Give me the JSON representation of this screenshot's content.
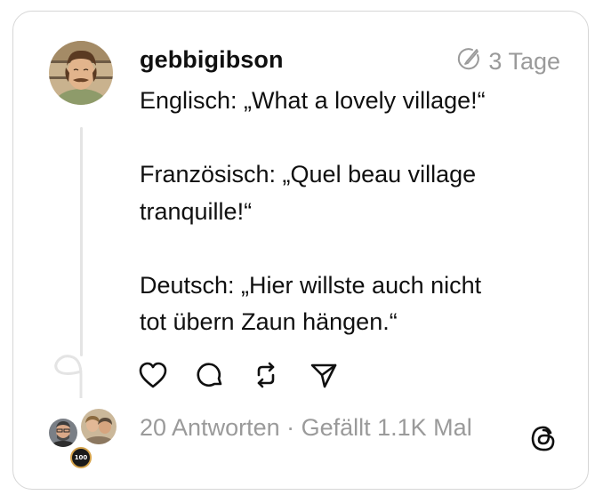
{
  "post": {
    "username": "gebbigibson",
    "time": "3 Tage",
    "lines": {
      "l1": "Englisch: „What a lovely village!“",
      "l2a": "Französisch: „Quel beau village",
      "l2b": "tranquille!“",
      "l3a": "Deutsch: „Hier willste auch nicht",
      "l3b": "tot übern Zaun hängen.“"
    },
    "stats": "20 Antworten · Gefällt 1.1K Mal",
    "badge": "100"
  },
  "icons": {
    "edited": "edited-icon",
    "like": "heart-icon",
    "reply": "comment-icon",
    "repost": "repost-icon",
    "share": "send-icon",
    "platform": "threads-logo-icon"
  },
  "colors": {
    "text": "#101010",
    "muted": "#9a9a9a",
    "border": "#d6d6d6",
    "thread_line": "#e4e4e4"
  }
}
